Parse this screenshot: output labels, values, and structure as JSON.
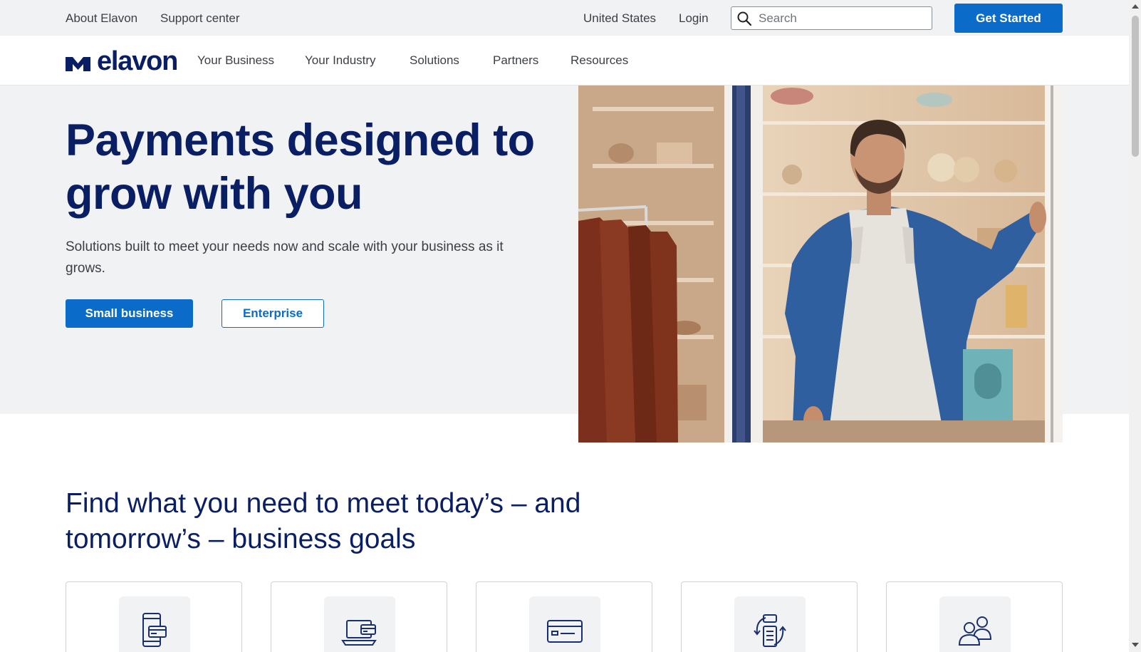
{
  "utility_bar": {
    "about": "About Elavon",
    "support": "Support center",
    "region": "United States",
    "login": "Login",
    "search_placeholder": "Search",
    "get_started": "Get Started"
  },
  "nav": {
    "logo_text": "elavon",
    "items": [
      "Your Business",
      "Your Industry",
      "Solutions",
      "Partners",
      "Resources"
    ]
  },
  "hero": {
    "title": "Payments designed to grow with you",
    "subtitle": "Solutions built to meet your needs now and scale with your business as it grows.",
    "primary_button": "Small business",
    "secondary_button": "Enterprise"
  },
  "section": {
    "title": "Find what you need to meet today’s – and tomorrow’s – business goals",
    "cards": [
      {
        "icon": "mobile-payment-icon"
      },
      {
        "icon": "laptop-payment-icon"
      },
      {
        "icon": "credit-card-icon"
      },
      {
        "icon": "transaction-cycle-icon"
      },
      {
        "icon": "people-icon"
      }
    ]
  },
  "colors": {
    "brand_navy": "#0a1f63",
    "accent_blue": "#0b6bc8",
    "light_gray_bg": "#f1f2f4"
  }
}
